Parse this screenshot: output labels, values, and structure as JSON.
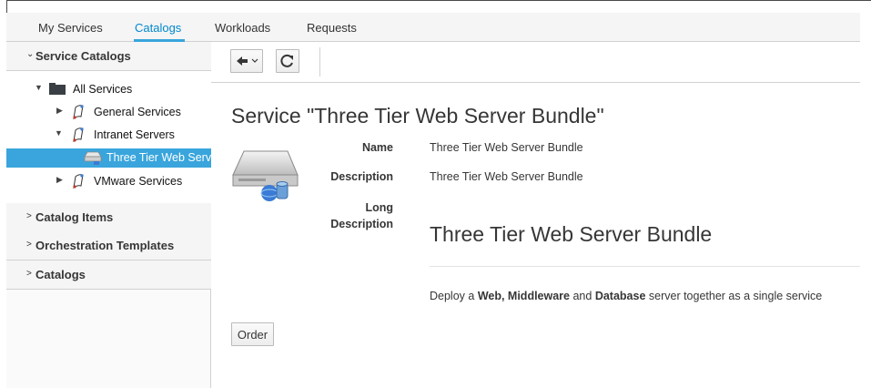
{
  "nav": {
    "tabs": [
      {
        "label": "My Services"
      },
      {
        "label": "Catalogs"
      },
      {
        "label": "Workloads"
      },
      {
        "label": "Requests"
      }
    ],
    "active_tab": "Catalogs"
  },
  "sidebar": {
    "sections": [
      {
        "label": "Service Catalogs",
        "expanded": true
      },
      {
        "label": "Catalog Items",
        "expanded": false
      },
      {
        "label": "Orchestration Templates",
        "expanded": false
      },
      {
        "label": "Catalogs",
        "expanded": false
      }
    ],
    "tree": [
      {
        "label": "All Services",
        "icon": "folder-icon",
        "expanded": true
      },
      {
        "label": "General Services",
        "icon": "catalog-icon",
        "expanded": false
      },
      {
        "label": "Intranet Servers",
        "icon": "catalog-icon",
        "expanded": true
      },
      {
        "label": "Three Tier Web Serve",
        "icon": "server-icon",
        "selected": true
      },
      {
        "label": "VMware Services",
        "icon": "catalog-icon",
        "expanded": false
      }
    ]
  },
  "toolbar": {
    "back_icon": "back-arrow-icon",
    "refresh_icon": "refresh-icon"
  },
  "service": {
    "title": "Service \"Three Tier Web Server Bundle\"",
    "fields": {
      "name_label": "Name",
      "name_value": "Three Tier Web Server Bundle",
      "description_label": "Description",
      "description_value": "Three Tier Web Server Bundle",
      "long_label_1": "Long",
      "long_label_2": "Description"
    },
    "long_description": {
      "heading": "Three Tier Web Server Bundle",
      "body_parts": [
        "Deploy a ",
        "Web, Middleware",
        " and ",
        "Database",
        " server together as a single service"
      ]
    },
    "order_label": "Order"
  },
  "colors": {
    "accent": "#0088ce",
    "selection": "#39a5dc"
  }
}
